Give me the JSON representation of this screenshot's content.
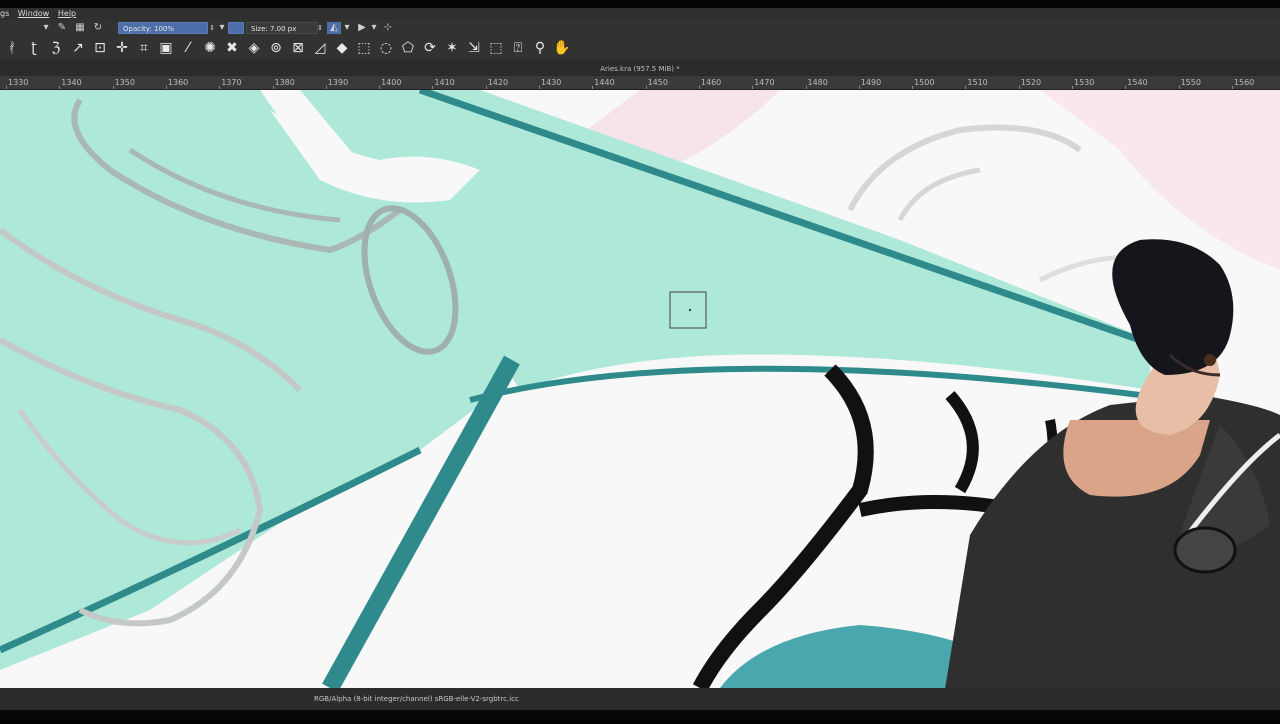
{
  "menubar": {
    "items": [
      "gs",
      "Window",
      "Help"
    ]
  },
  "options": {
    "opacity_label": "Opacity: 100%",
    "size_label": "Size: 7.00 px"
  },
  "document": {
    "title": "Aries.kra (957.5 MiB) *"
  },
  "ruler": {
    "ticks": [
      "1330",
      "1340",
      "1350",
      "1360",
      "1370",
      "1380",
      "1390",
      "1400",
      "1410",
      "1420",
      "1430",
      "1440",
      "1450",
      "1460",
      "1470",
      "1480",
      "1490",
      "1500",
      "1510",
      "1520",
      "1530",
      "1540",
      "1550",
      "1560"
    ]
  },
  "status": {
    "colorspace": "RGB/Alpha (8-bit integer/channel)  sRGB-elle-V2-srgbtrc.icc"
  },
  "tools": [
    "freehand-brush-icon",
    "calligraphy-icon",
    "line-icon",
    "bezier-icon",
    "transform-icon",
    "move-icon",
    "crop-icon",
    "gradient-icon",
    "color-picker-icon",
    "smart-patch-icon",
    "fill-icon",
    "assistant-icon",
    "measure-icon",
    "reference-icon",
    "rect-select-icon",
    "ellipse-select-icon",
    "polygon-select-icon",
    "freehand-select-icon",
    "contiguous-select-icon",
    "similar-select-icon",
    "bezier-select-icon",
    "magnetic-select-icon",
    "zoom-icon",
    "pan-icon"
  ],
  "colors": {
    "mint": "#aee8d9",
    "teal": "#2f8a8c",
    "panel": "#323232"
  }
}
